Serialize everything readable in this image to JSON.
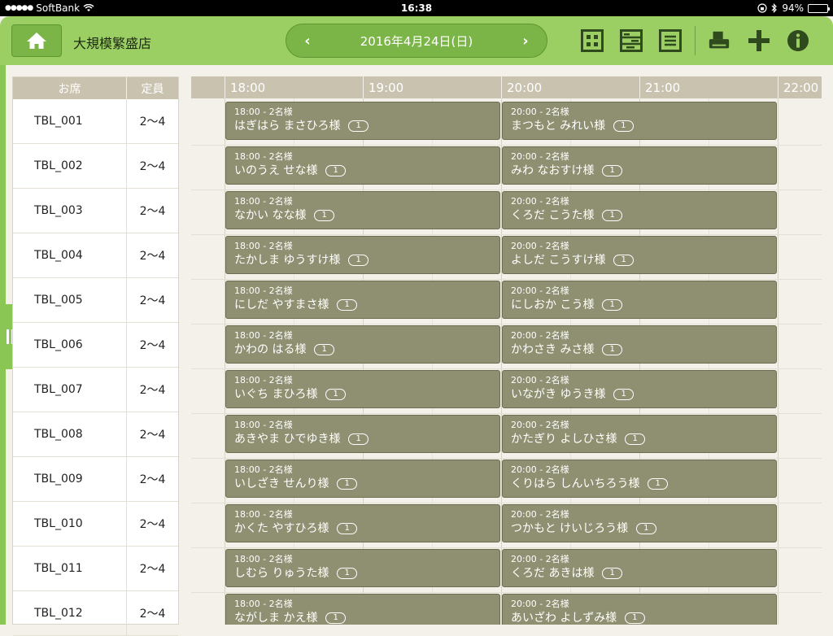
{
  "status_bar": {
    "carrier": "SoftBank",
    "time": "16:38",
    "battery": "94%",
    "battery_level": 0.94
  },
  "header": {
    "store_name": "大規模繁盛店",
    "date": "2016年4月24日(日)",
    "prev_label": "‹",
    "next_label": "›",
    "icons": [
      "home-icon",
      "seat-map-icon",
      "timeline-icon",
      "list-icon",
      "printer-icon",
      "add-icon",
      "info-icon"
    ]
  },
  "colors": {
    "header_green": "#9bcf64",
    "button_green": "#7bb547",
    "column_header": "#c9c2ae",
    "booking": "#8f8f71",
    "icon_dark": "#2f4a1c"
  },
  "seat_table": {
    "headers": {
      "seat": "お席",
      "capacity": "定員"
    },
    "rows": [
      {
        "name": "TBL_001",
        "capacity": "2〜4"
      },
      {
        "name": "TBL_002",
        "capacity": "2〜4"
      },
      {
        "name": "TBL_003",
        "capacity": "2〜4"
      },
      {
        "name": "TBL_004",
        "capacity": "2〜4"
      },
      {
        "name": "TBL_005",
        "capacity": "2〜4"
      },
      {
        "name": "TBL_006",
        "capacity": "2〜4"
      },
      {
        "name": "TBL_007",
        "capacity": "2〜4"
      },
      {
        "name": "TBL_008",
        "capacity": "2〜4"
      },
      {
        "name": "TBL_009",
        "capacity": "2〜4"
      },
      {
        "name": "TBL_010",
        "capacity": "2〜4"
      },
      {
        "name": "TBL_011",
        "capacity": "2〜4"
      },
      {
        "name": "TBL_012",
        "capacity": "2〜4"
      }
    ]
  },
  "timeline": {
    "hours": [
      "18:00",
      "19:00",
      "20:00",
      "21:00",
      "22:00"
    ],
    "reservations": [
      [
        {
          "time": "18:00 - 2名様",
          "name": "はぎはら まさひろ様",
          "badge": "1"
        },
        {
          "time": "20:00 - 2名様",
          "name": "まつもと みれい様",
          "badge": "1"
        }
      ],
      [
        {
          "time": "18:00 - 2名様",
          "name": "いのうえ せな様",
          "badge": "1"
        },
        {
          "time": "20:00 - 2名様",
          "name": "みわ なおすけ様",
          "badge": "1"
        }
      ],
      [
        {
          "time": "18:00 - 2名様",
          "name": "なかい なな様",
          "badge": "1"
        },
        {
          "time": "20:00 - 2名様",
          "name": "くろだ こうた様",
          "badge": "1"
        }
      ],
      [
        {
          "time": "18:00 - 2名様",
          "name": "たかしま ゆうすけ様",
          "badge": "1"
        },
        {
          "time": "20:00 - 2名様",
          "name": "よしだ こうすけ様",
          "badge": "1"
        }
      ],
      [
        {
          "time": "18:00 - 2名様",
          "name": "にしだ やすまさ様",
          "badge": "1"
        },
        {
          "time": "20:00 - 2名様",
          "name": "にしおか こう様",
          "badge": "1"
        }
      ],
      [
        {
          "time": "18:00 - 2名様",
          "name": "かわの はる様",
          "badge": "1"
        },
        {
          "time": "20:00 - 2名様",
          "name": "かわさき みさ様",
          "badge": "1"
        }
      ],
      [
        {
          "time": "18:00 - 2名様",
          "name": "いぐち まひろ様",
          "badge": "1"
        },
        {
          "time": "20:00 - 2名様",
          "name": "いながき ゆうき様",
          "badge": "1"
        }
      ],
      [
        {
          "time": "18:00 - 2名様",
          "name": "あきやま ひでゆき様",
          "badge": "1"
        },
        {
          "time": "20:00 - 2名様",
          "name": "かたぎり よしひさ様",
          "badge": "1"
        }
      ],
      [
        {
          "time": "18:00 - 2名様",
          "name": "いしざき せんり様",
          "badge": "1"
        },
        {
          "time": "20:00 - 2名様",
          "name": "くりはら しんいちろう様",
          "badge": "1"
        }
      ],
      [
        {
          "time": "18:00 - 2名様",
          "name": "かくた やすひろ様",
          "badge": "1"
        },
        {
          "time": "20:00 - 2名様",
          "name": "つかもと けいじろう様",
          "badge": "1"
        }
      ],
      [
        {
          "time": "18:00 - 2名様",
          "name": "しむら りゅうた様",
          "badge": "1"
        },
        {
          "time": "20:00 - 2名様",
          "name": "くろだ あきは様",
          "badge": "1"
        }
      ],
      [
        {
          "time": "18:00 - 2名様",
          "name": "ながしま かえ様",
          "badge": "1"
        },
        {
          "time": "20:00 - 2名様",
          "name": "あいざわ よしずみ様",
          "badge": "1"
        }
      ]
    ]
  }
}
